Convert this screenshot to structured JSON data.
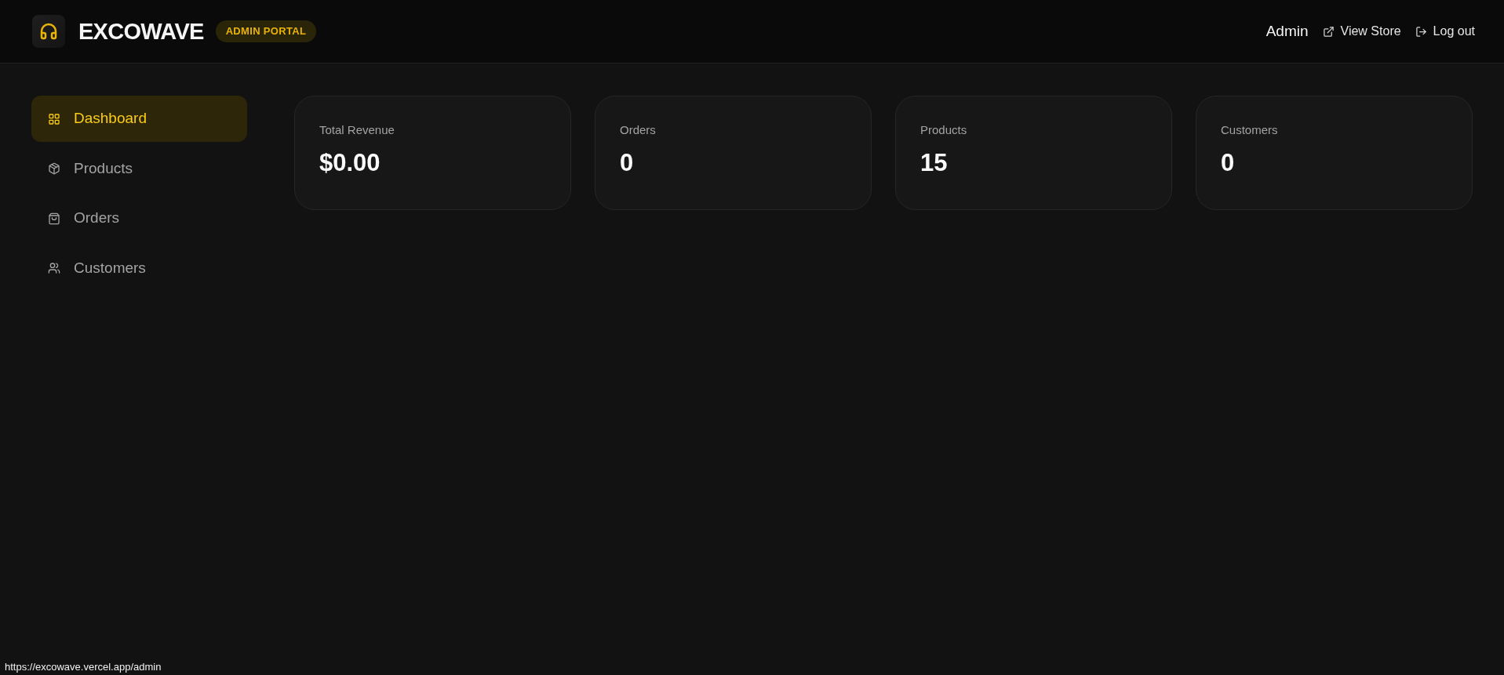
{
  "header": {
    "logo_text": "EXCOWAVE",
    "badge": "ADMIN PORTAL",
    "user": "Admin",
    "links": [
      {
        "kind": "external",
        "label": "View Store"
      },
      {
        "kind": "logout",
        "label": "Log out"
      }
    ]
  },
  "sidebar": {
    "items": [
      {
        "kind": "dashboard",
        "label": "Dashboard",
        "selected": true
      },
      {
        "kind": "products",
        "label": "Products",
        "selected": false
      },
      {
        "kind": "orders",
        "label": "Orders",
        "selected": false
      },
      {
        "kind": "customers",
        "label": "Customers",
        "selected": false
      }
    ]
  },
  "stats": [
    {
      "label": "Total Revenue",
      "value": "$0.00"
    },
    {
      "label": "Orders",
      "value": "0"
    },
    {
      "label": "Products",
      "value": "15"
    },
    {
      "label": "Customers",
      "value": "0"
    }
  ],
  "status_bar": {
    "url": "https://excowave.vercel.app/admin"
  }
}
